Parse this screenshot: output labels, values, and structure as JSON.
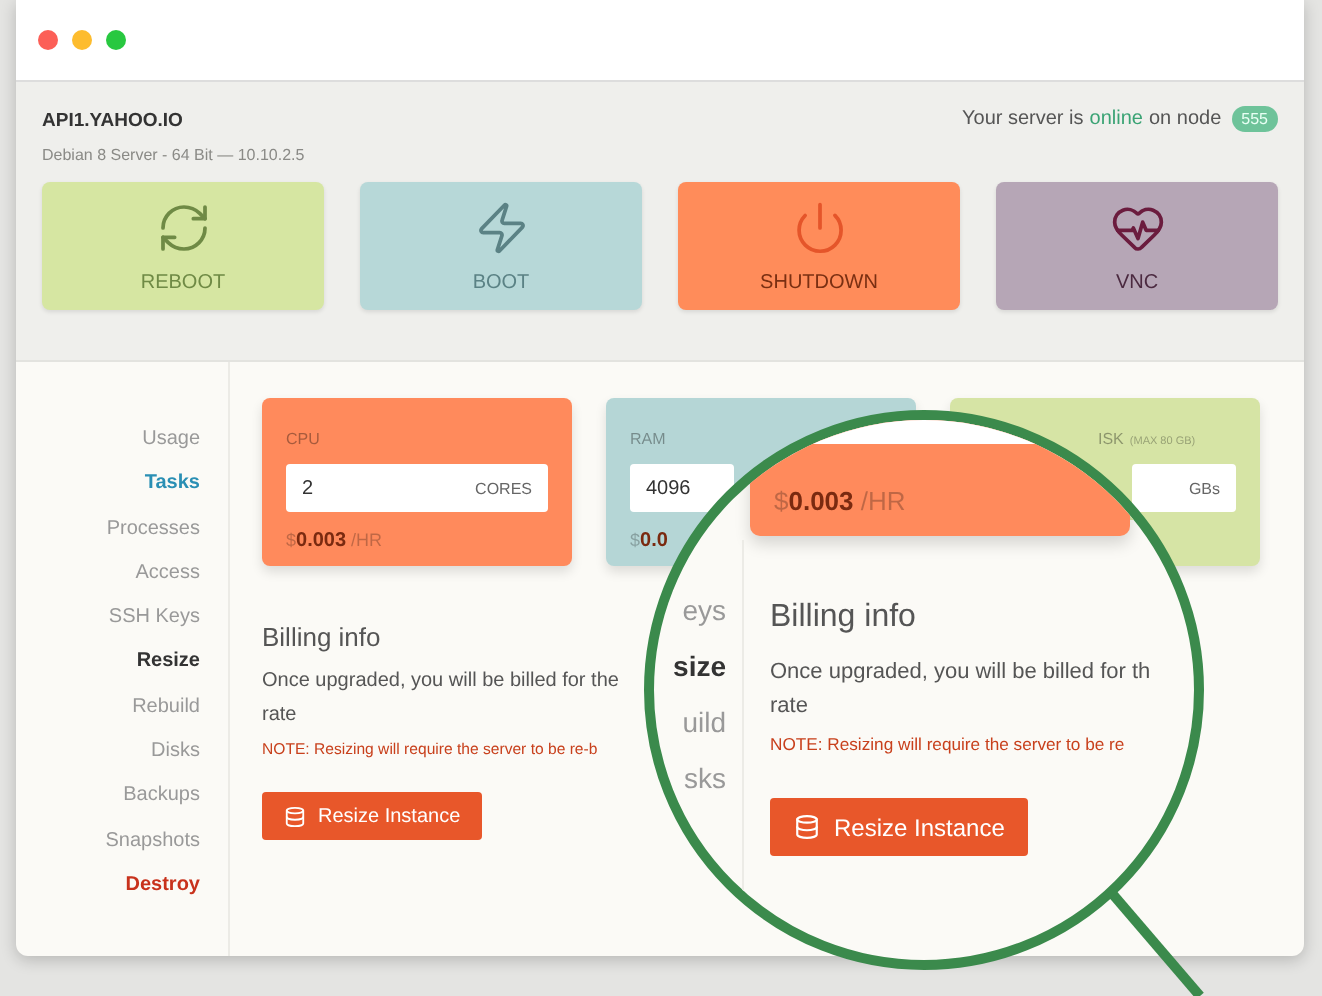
{
  "window": {
    "controls": [
      {
        "kind": "close"
      },
      {
        "kind": "minimize"
      },
      {
        "kind": "zoom"
      }
    ]
  },
  "server": {
    "name": "API1.YAHOO.IO",
    "details": "Debian 8 Server - 64 Bit — 10.10.2.5",
    "status_prefix": "Your server is",
    "status": "online",
    "status_suffix": "on node",
    "node": "555"
  },
  "actions": [
    {
      "kind": "reboot",
      "label": "REBOOT"
    },
    {
      "kind": "boot",
      "label": "BOOT"
    },
    {
      "kind": "shutdown",
      "label": "SHUTDOWN"
    },
    {
      "kind": "vnc",
      "label": "VNC"
    }
  ],
  "sidebar": {
    "items": [
      {
        "label": "Usage",
        "kind": "normal",
        "selected": false
      },
      {
        "label": "Tasks",
        "kind": "link",
        "selected": false
      },
      {
        "label": "Processes",
        "kind": "normal",
        "selected": false
      },
      {
        "label": "Access",
        "kind": "normal",
        "selected": false
      },
      {
        "label": "SSH Keys",
        "kind": "normal",
        "selected": false
      },
      {
        "label": "Resize",
        "kind": "normal",
        "selected": true
      },
      {
        "label": "Rebuild",
        "kind": "normal",
        "selected": false
      },
      {
        "label": "Disks",
        "kind": "normal",
        "selected": false
      },
      {
        "label": "Backups",
        "kind": "normal",
        "selected": false
      },
      {
        "label": "Snapshots",
        "kind": "normal",
        "selected": false
      },
      {
        "label": "Destroy",
        "kind": "danger",
        "selected": false
      }
    ]
  },
  "resources": [
    {
      "kind": "cpu",
      "label": "CPU",
      "value": "2",
      "unit": "CORES",
      "price": "$**0.003** /HR"
    },
    {
      "kind": "ram",
      "label": "RAM",
      "value": "4096",
      "price": "$**0.0**"
    },
    {
      "kind": "disk",
      "label": "ISK",
      "note": "(MAX 80 GB)",
      "unit": "GBs"
    }
  ],
  "billing": {
    "title": "Billing info",
    "lines": [
      "Once upgraded, you will be billed for the",
      "rate"
    ],
    "note": "NOTE: Resizing will require the server to be re-b",
    "button": "Resize Instance"
  },
  "magnifier": {
    "sidebar_fragments": [
      {
        "text": "eys",
        "selected": false
      },
      {
        "text": "size",
        "selected": true
      },
      {
        "text": "uild",
        "selected": false
      },
      {
        "text": "sks",
        "selected": false
      }
    ],
    "price": "$**0.003** /HR",
    "title": "Billing info",
    "lines": [
      "Once upgraded, you will be billed for th",
      "rate"
    ],
    "note": "NOTE: Resizing will require the server to be re",
    "button": "Resize Instance"
  }
}
